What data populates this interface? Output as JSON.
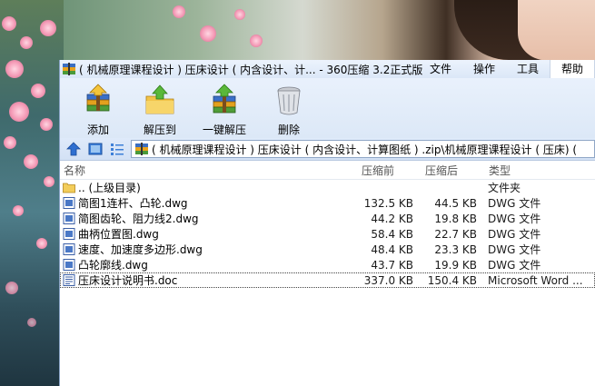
{
  "window": {
    "title": "( 机械原理课程设计 ) 压床设计 ( 内含设计、计... - 360压缩 3.2正式版"
  },
  "menu": [
    {
      "label": "文件"
    },
    {
      "label": "操作"
    },
    {
      "label": "工具"
    },
    {
      "label": "帮助"
    }
  ],
  "toolbar": [
    {
      "label": "添加",
      "icon": "add-archive-icon"
    },
    {
      "label": "解压到",
      "icon": "extract-to-icon"
    },
    {
      "label": "一键解压",
      "icon": "one-click-extract-icon"
    },
    {
      "label": "删除",
      "icon": "delete-bin-icon"
    }
  ],
  "address": {
    "path": "( 机械原理课程设计 ) 压床设计 ( 内含设计、计算图纸 ) .zip\\机械原理课程设计 ( 压床) ("
  },
  "columns": {
    "name": "名称",
    "before": "压缩前",
    "after": "压缩后",
    "type": "类型"
  },
  "files": [
    {
      "name": ".. (上级目录)",
      "before": "",
      "after": "",
      "type": "文件夹",
      "icon": "folder-icon"
    },
    {
      "name": "简图1连杆、凸轮.dwg",
      "before": "132.5 KB",
      "after": "44.5 KB",
      "type": "DWG 文件",
      "icon": "dwg-file-icon"
    },
    {
      "name": "简图齿轮、阻力线2.dwg",
      "before": "44.2 KB",
      "after": "19.8 KB",
      "type": "DWG 文件",
      "icon": "dwg-file-icon"
    },
    {
      "name": "曲柄位置图.dwg",
      "before": "58.4 KB",
      "after": "22.7 KB",
      "type": "DWG 文件",
      "icon": "dwg-file-icon"
    },
    {
      "name": "速度、加速度多边形.dwg",
      "before": "48.4 KB",
      "after": "23.3 KB",
      "type": "DWG 文件",
      "icon": "dwg-file-icon"
    },
    {
      "name": "凸轮廓线.dwg",
      "before": "43.7 KB",
      "after": "19.9 KB",
      "type": "DWG 文件",
      "icon": "dwg-file-icon"
    },
    {
      "name": "压床设计说明书.doc",
      "before": "337.0 KB",
      "after": "150.4 KB",
      "type": "Microsoft Word ...",
      "icon": "word-doc-icon"
    }
  ],
  "colors": {
    "titlebar": "#dbe7f7",
    "toolbar": "#dce8f7",
    "window_bg": "#ffffff"
  }
}
